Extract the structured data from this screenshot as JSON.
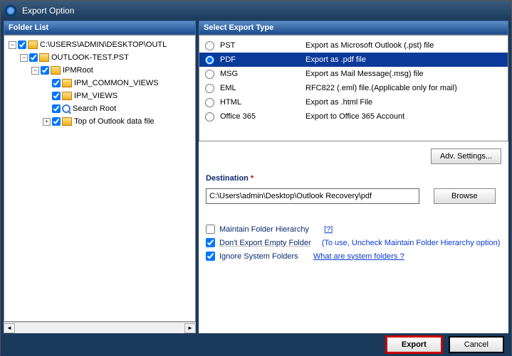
{
  "window": {
    "title": "Export Option"
  },
  "folderList": {
    "header": "Folder List",
    "items": [
      {
        "level": 0,
        "expander": "-",
        "checked": true,
        "icon": "folder",
        "label": "C:\\USERS\\ADMIN\\DESKTOP\\OUTL"
      },
      {
        "level": 1,
        "expander": "-",
        "checked": true,
        "icon": "folder",
        "label": "OUTLOOK-TEST.PST"
      },
      {
        "level": 2,
        "expander": "-",
        "checked": true,
        "icon": "folder",
        "label": "IPMRoot"
      },
      {
        "level": 3,
        "expander": "",
        "checked": true,
        "icon": "folder",
        "label": "IPM_COMMON_VIEWS"
      },
      {
        "level": 3,
        "expander": "",
        "checked": true,
        "icon": "folder",
        "label": "IPM_VIEWS"
      },
      {
        "level": 3,
        "expander": "",
        "checked": true,
        "icon": "search",
        "label": "Search Root"
      },
      {
        "level": 3,
        "expander": "+",
        "checked": true,
        "icon": "folder",
        "label": "Top of Outlook data file"
      }
    ]
  },
  "exportType": {
    "header": "Select Export Type",
    "selectedIndex": 1,
    "options": [
      {
        "code": "PST",
        "desc": "Export as Microsoft Outlook (.pst) file"
      },
      {
        "code": "PDF",
        "desc": "Export as .pdf file"
      },
      {
        "code": "MSG",
        "desc": "Export as Mail Message(.msg) file"
      },
      {
        "code": "EML",
        "desc": "RFC822 (.eml) file.(Applicable only for mail)"
      },
      {
        "code": "HTML",
        "desc": "Export as .html File"
      },
      {
        "code": "Office 365",
        "desc": "Export to Office 365 Account"
      }
    ]
  },
  "buttons": {
    "advSettings": "Adv. Settings...",
    "browse": "Browse",
    "export": "Export",
    "cancel": "Cancel"
  },
  "destination": {
    "label": "Destination",
    "asterisk": "*",
    "path": "C:\\Users\\admin\\Desktop\\Outlook Recovery\\pdf"
  },
  "options": {
    "maintainHierarchy": {
      "label": "Maintain Folder Hierarchy",
      "help": "[?]",
      "checked": false
    },
    "dontExportEmpty": {
      "label": "Don't Export Empty Folder",
      "hint": "(To use, Uncheck Maintain Folder Hierarchy option)",
      "checked": true
    },
    "ignoreSystem": {
      "label": "Ignore System Folders",
      "link": "What are system folders ?",
      "checked": true
    }
  }
}
